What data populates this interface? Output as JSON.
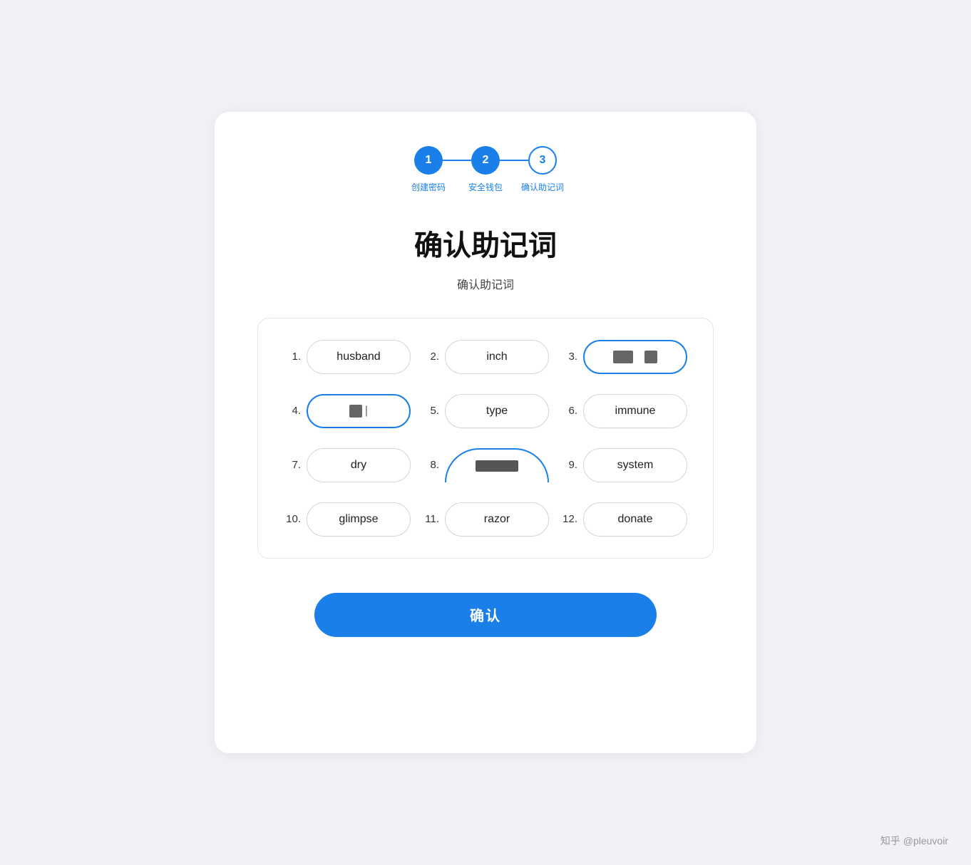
{
  "steps": {
    "items": [
      {
        "number": "1",
        "label": "创建密码",
        "state": "active"
      },
      {
        "number": "2",
        "label": "安全钱包",
        "state": "active"
      },
      {
        "number": "3",
        "label": "确认助记词",
        "state": "outline"
      }
    ]
  },
  "page": {
    "title": "确认助记词",
    "subtitle": "确认助记词"
  },
  "words": [
    {
      "number": "1.",
      "text": "husband",
      "state": "normal"
    },
    {
      "number": "2.",
      "text": "inch",
      "state": "normal"
    },
    {
      "number": "3.",
      "text": "[redacted-double]",
      "state": "highlighted"
    },
    {
      "number": "4.",
      "text": "[redacted-single]",
      "state": "highlighted-cursor"
    },
    {
      "number": "5.",
      "text": "type",
      "state": "normal"
    },
    {
      "number": "6.",
      "text": "immune",
      "state": "normal"
    },
    {
      "number": "7.",
      "text": "dry",
      "state": "normal"
    },
    {
      "number": "8.",
      "text": "[redacted-long]",
      "state": "highlighted-partial"
    },
    {
      "number": "9.",
      "text": "system",
      "state": "normal"
    },
    {
      "number": "10.",
      "text": "glimpse",
      "state": "normal"
    },
    {
      "number": "11.",
      "text": "razor",
      "state": "normal"
    },
    {
      "number": "12.",
      "text": "donate",
      "state": "normal"
    }
  ],
  "button": {
    "label": "确认"
  },
  "watermark": "知乎 @pleuvoir"
}
